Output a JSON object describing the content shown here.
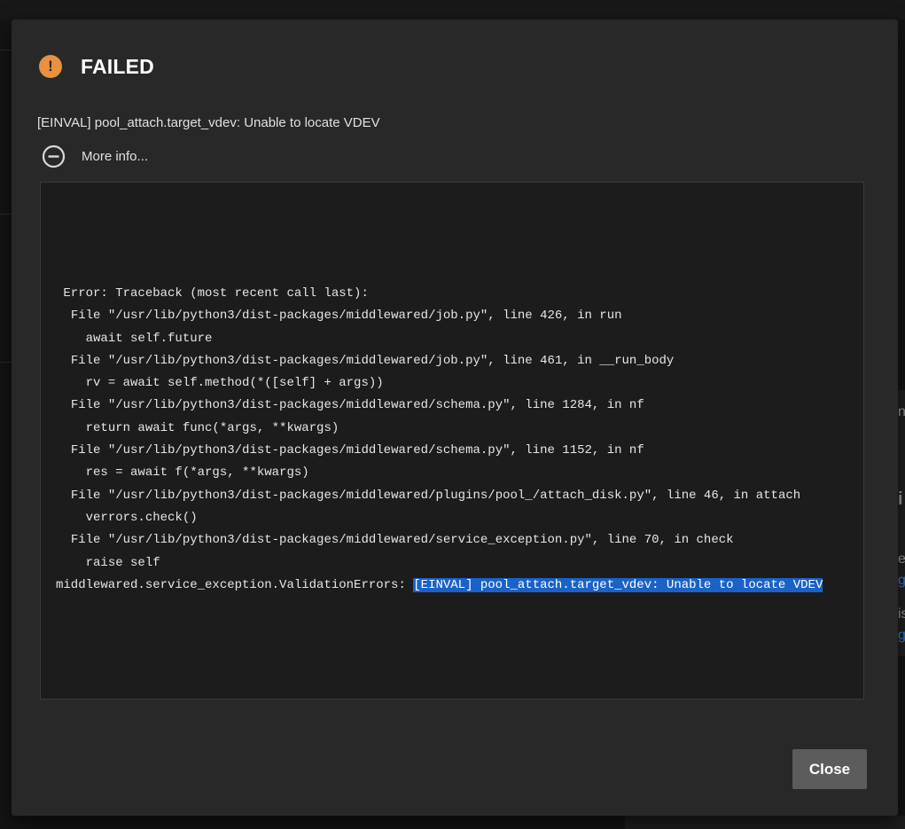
{
  "dialog": {
    "icon": "alert-circle-icon",
    "title": "FAILED",
    "message": "[EINVAL] pool_attach.target_vdev: Unable to locate VDEV",
    "more_info_icon": "minus-circle-icon",
    "more_info_label": "More info...",
    "traceback": {
      "lines": [
        " Error: Traceback (most recent call last):",
        "  File \"/usr/lib/python3/dist-packages/middlewared/job.py\", line 426, in run",
        "    await self.future",
        "  File \"/usr/lib/python3/dist-packages/middlewared/job.py\", line 461, in __run_body",
        "    rv = await self.method(*([self] + args))",
        "  File \"/usr/lib/python3/dist-packages/middlewared/schema.py\", line 1284, in nf",
        "    return await func(*args, **kwargs)",
        "  File \"/usr/lib/python3/dist-packages/middlewared/schema.py\", line 1152, in nf",
        "    res = await f(*args, **kwargs)",
        "  File \"/usr/lib/python3/dist-packages/middlewared/plugins/pool_/attach_disk.py\", line 46, in attach",
        "    verrors.check()",
        "  File \"/usr/lib/python3/dist-packages/middlewared/service_exception.py\", line 70, in check",
        "    raise self"
      ],
      "last_line_prefix": "middlewared.service_exception.ValidationErrors: ",
      "last_line_highlight": "[EINVAL] pool_attach.target_vdev: Unable to locate VDEV"
    },
    "close_label": "Close",
    "highlight_color": "#1a62c9",
    "alert_color": "#e8913f"
  },
  "background": {
    "right_fragments": [
      "n",
      "i",
      "e",
      "g",
      "is",
      "g"
    ]
  }
}
